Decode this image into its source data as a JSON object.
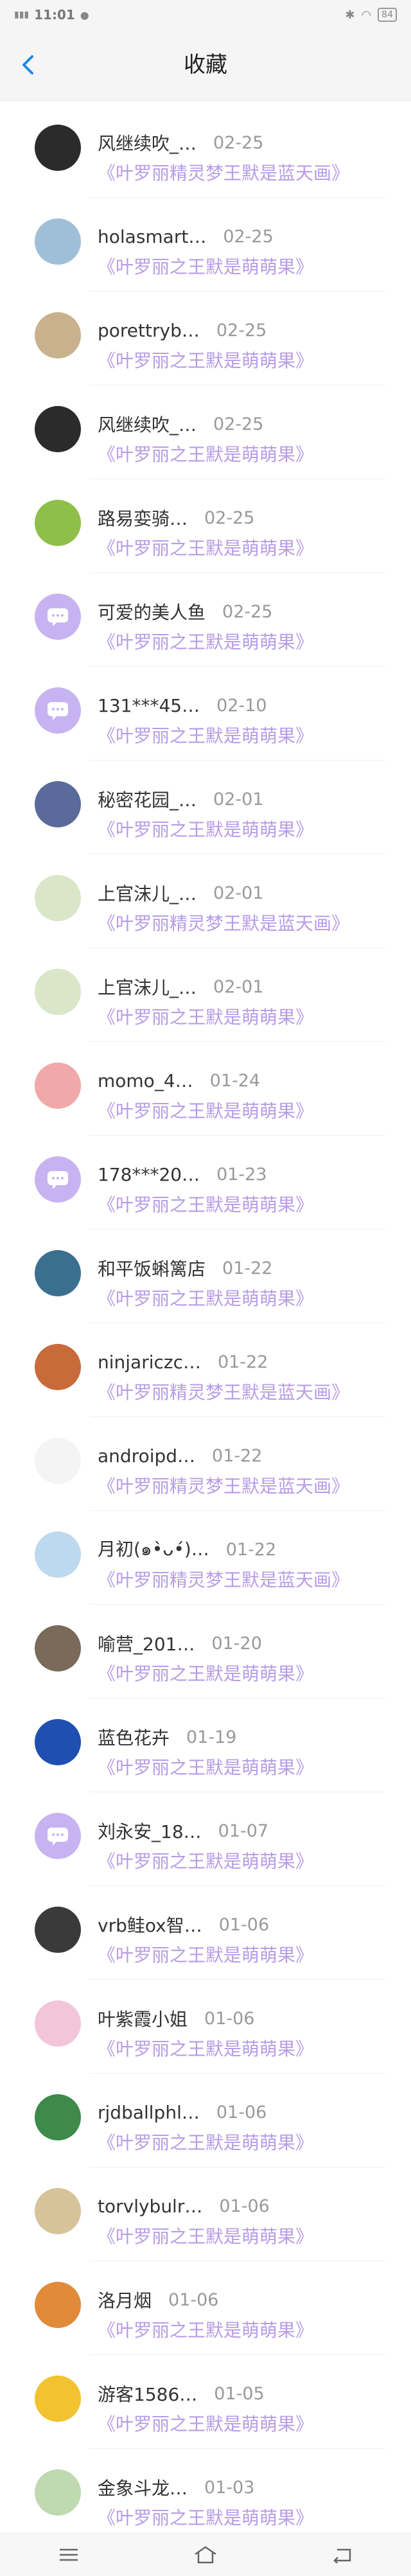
{
  "status_bar": {
    "time": "11:01",
    "battery": "84"
  },
  "header": {
    "title": "收藏"
  },
  "favorites": [
    {
      "user": "风继续吹_…",
      "date": "02-25",
      "title": "《叶罗丽精灵梦王默是蓝天画》",
      "avatar_color": "#2b2b2b"
    },
    {
      "user": "holasmart…",
      "date": "02-25",
      "title": "《叶罗丽之王默是萌萌果》",
      "avatar_color": "#9fbfd8"
    },
    {
      "user": "porettryb…",
      "date": "02-25",
      "title": "《叶罗丽之王默是萌萌果》",
      "avatar_color": "#c9b18d"
    },
    {
      "user": "风继续吹_…",
      "date": "02-25",
      "title": "《叶罗丽之王默是萌萌果》",
      "avatar_color": "#2b2b2b"
    },
    {
      "user": "路易娈骑…",
      "date": "02-25",
      "title": "《叶罗丽之王默是萌萌果》",
      "avatar_color": "#8fbf4a"
    },
    {
      "user": "可爱的美人鱼",
      "date": "02-25",
      "title": "《叶罗丽之王默是萌萌果》",
      "avatar_color": "#c7b3f2"
    },
    {
      "user": "131***45…",
      "date": "02-10",
      "title": "《叶罗丽之王默是萌萌果》",
      "avatar_color": "#c7b3f2"
    },
    {
      "user": "秘密花园_…",
      "date": "02-01",
      "title": "《叶罗丽之王默是萌萌果》",
      "avatar_color": "#5a6a9a"
    },
    {
      "user": "上官沫儿_…",
      "date": "02-01",
      "title": "《叶罗丽精灵梦王默是蓝天画》",
      "avatar_color": "#d9e6c8"
    },
    {
      "user": "上官沫儿_…",
      "date": "02-01",
      "title": "《叶罗丽之王默是萌萌果》",
      "avatar_color": "#d9e6c8"
    },
    {
      "user": "momo_4…",
      "date": "01-24",
      "title": "《叶罗丽之王默是萌萌果》",
      "avatar_color": "#f0a8a8"
    },
    {
      "user": "178***20…",
      "date": "01-23",
      "title": "《叶罗丽之王默是萌萌果》",
      "avatar_color": "#c7b3f2"
    },
    {
      "user": "和平饭蝌篱店",
      "date": "01-22",
      "title": "《叶罗丽之王默是萌萌果》",
      "avatar_color": "#3a6f8f"
    },
    {
      "user": "ninjariczc…",
      "date": "01-22",
      "title": "《叶罗丽精灵梦王默是蓝天画》",
      "avatar_color": "#c86a3a"
    },
    {
      "user": "androipd…",
      "date": "01-22",
      "title": "《叶罗丽精灵梦王默是蓝天画》",
      "avatar_color": "#f4f4f4"
    },
    {
      "user": "月初(๑•̀ᴗ•́)…",
      "date": "01-22",
      "title": "《叶罗丽精灵梦王默是蓝天画》",
      "avatar_color": "#bcd9ef"
    },
    {
      "user": "喻营_201…",
      "date": "01-20",
      "title": "《叶罗丽之王默是萌萌果》",
      "avatar_color": "#7a6a5a"
    },
    {
      "user": "蓝色花卉",
      "date": "01-19",
      "title": "《叶罗丽之王默是萌萌果》",
      "avatar_color": "#1f4fb0"
    },
    {
      "user": "刘永安_18…",
      "date": "01-07",
      "title": "《叶罗丽之王默是萌萌果》",
      "avatar_color": "#c7b3f2"
    },
    {
      "user": "vrb鲑ox智…",
      "date": "01-06",
      "title": "《叶罗丽之王默是萌萌果》",
      "avatar_color": "#3a3a3a"
    },
    {
      "user": "叶紫霞小姐",
      "date": "01-06",
      "title": "《叶罗丽之王默是萌萌果》",
      "avatar_color": "#f2c6d8"
    },
    {
      "user": "rjdballphl…",
      "date": "01-06",
      "title": "《叶罗丽之王默是萌萌果》",
      "avatar_color": "#3d8a4a"
    },
    {
      "user": "torvlybulr…",
      "date": "01-06",
      "title": "《叶罗丽之王默是萌萌果》",
      "avatar_color": "#d6c39a"
    },
    {
      "user": "洛月烟",
      "date": "01-06",
      "title": "《叶罗丽之王默是萌萌果》",
      "avatar_color": "#e08a3a"
    },
    {
      "user": "游客1586…",
      "date": "01-05",
      "title": "《叶罗丽之王默是萌萌果》",
      "avatar_color": "#f2c230"
    },
    {
      "user": "金象斗龙…",
      "date": "01-03",
      "title": "《叶罗丽之王默是萌萌果》",
      "avatar_color": "#bfd9b0"
    }
  ],
  "icons": {
    "back": "chevron-left-icon",
    "nav_menu": "menu-icon",
    "nav_home": "home-icon",
    "nav_back": "back-arrow-icon",
    "default_avatar": "chat-bubble-icon"
  },
  "colors": {
    "accent": "#1e88e5",
    "subtitle": "#b79ce6",
    "default_avatar": "#c7b3f2"
  }
}
